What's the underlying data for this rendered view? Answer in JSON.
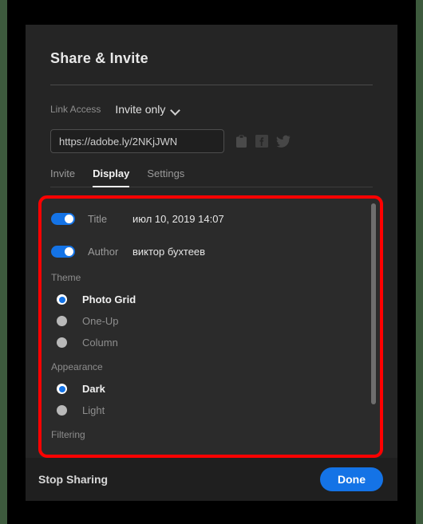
{
  "dialog": {
    "title": "Share & Invite",
    "link_access": {
      "label": "Link Access",
      "value": "Invite only",
      "chevron_icon": "chevron-down-icon"
    },
    "url": {
      "value": "https://adobe.ly/2NKjJWN",
      "placeholder": "https://"
    },
    "share_icons": [
      {
        "name": "clipboard-icon",
        "title": "Copy link"
      },
      {
        "name": "facebook-icon",
        "title": "Share on Facebook"
      },
      {
        "name": "twitter-icon",
        "title": "Share on Twitter"
      }
    ],
    "tabs": [
      {
        "label": "Invite",
        "active": false
      },
      {
        "label": "Display",
        "active": true
      },
      {
        "label": "Settings",
        "active": false
      }
    ]
  },
  "display_panel": {
    "highlight_color": "#ff0000",
    "toggles": [
      {
        "label": "Title",
        "value": "июл 10, 2019 14:07",
        "on": true
      },
      {
        "label": "Author",
        "value": "виктор бухтеев",
        "on": true
      }
    ],
    "groups": [
      {
        "label": "Theme",
        "options": [
          {
            "label": "Photo Grid",
            "selected": true
          },
          {
            "label": "One-Up",
            "selected": false
          },
          {
            "label": "Column",
            "selected": false
          }
        ]
      },
      {
        "label": "Appearance",
        "options": [
          {
            "label": "Dark",
            "selected": true
          },
          {
            "label": "Light",
            "selected": false
          }
        ]
      }
    ],
    "trailing_group_label": "Filtering"
  },
  "footer": {
    "stop_sharing_label": "Stop Sharing",
    "done_label": "Done",
    "accent_color": "#1473e6"
  }
}
